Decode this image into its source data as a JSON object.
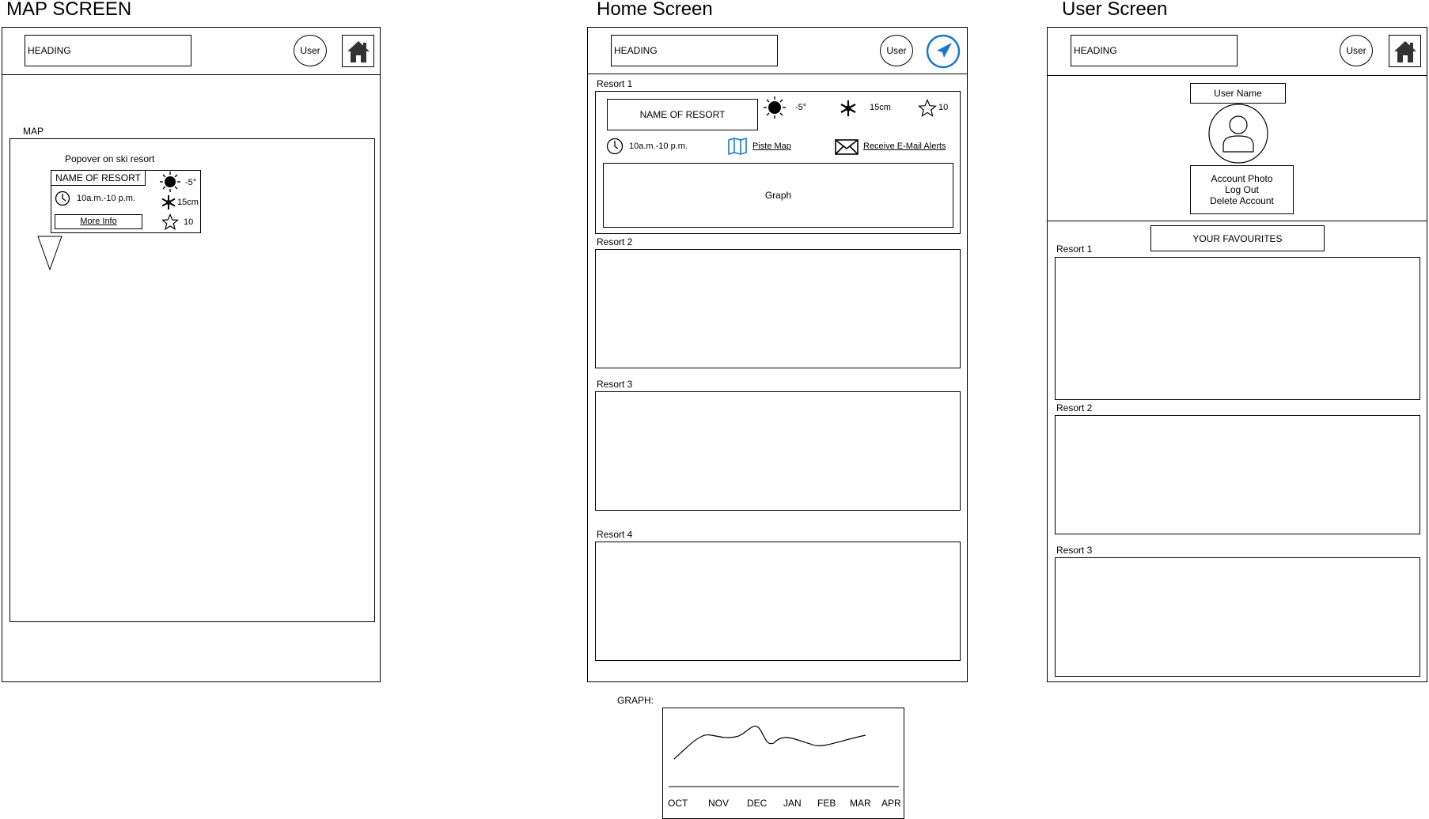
{
  "map_screen": {
    "title": "MAP SCREEN",
    "heading": "HEADING",
    "user": "User",
    "map_label": "MAP",
    "popover_caption": "Popover on ski resort",
    "popover": {
      "resort_name": "NAME OF RESORT",
      "temperature": "-5°",
      "hours": "10a.m.-10 p.m.",
      "snow": "15cm",
      "more_info": "More Info",
      "rating": "10"
    }
  },
  "home_screen": {
    "title": "Home Screen",
    "heading": "HEADING",
    "user": "User",
    "resorts": [
      {
        "label": "Resort 1",
        "name": "NAME OF RESORT",
        "temperature": "-5°",
        "snow": "15cm",
        "rating": "10",
        "hours": "10a.m.-10 p.m.",
        "piste_map": "Piste Map",
        "email_alerts": "Receive E-Mail Alerts",
        "graph": "Graph"
      },
      {
        "label": "Resort 2"
      },
      {
        "label": "Resort 3"
      },
      {
        "label": "Resort 4"
      }
    ]
  },
  "user_screen": {
    "title": "User Screen",
    "heading": "HEADING",
    "user": "User",
    "user_name": "User Name",
    "account_photo": "Account Photo",
    "log_out": "Log Out",
    "delete_account": "Delete Account",
    "favourites": "YOUR FAVOURITES",
    "resorts": [
      "Resort 1",
      "Resort 2",
      "Resort 3"
    ]
  },
  "graph_sketch": {
    "label": "GRAPH:",
    "months": [
      "OCT",
      "NOV",
      "DEC",
      "JAN",
      "FEB",
      "MAR",
      "APR"
    ]
  }
}
